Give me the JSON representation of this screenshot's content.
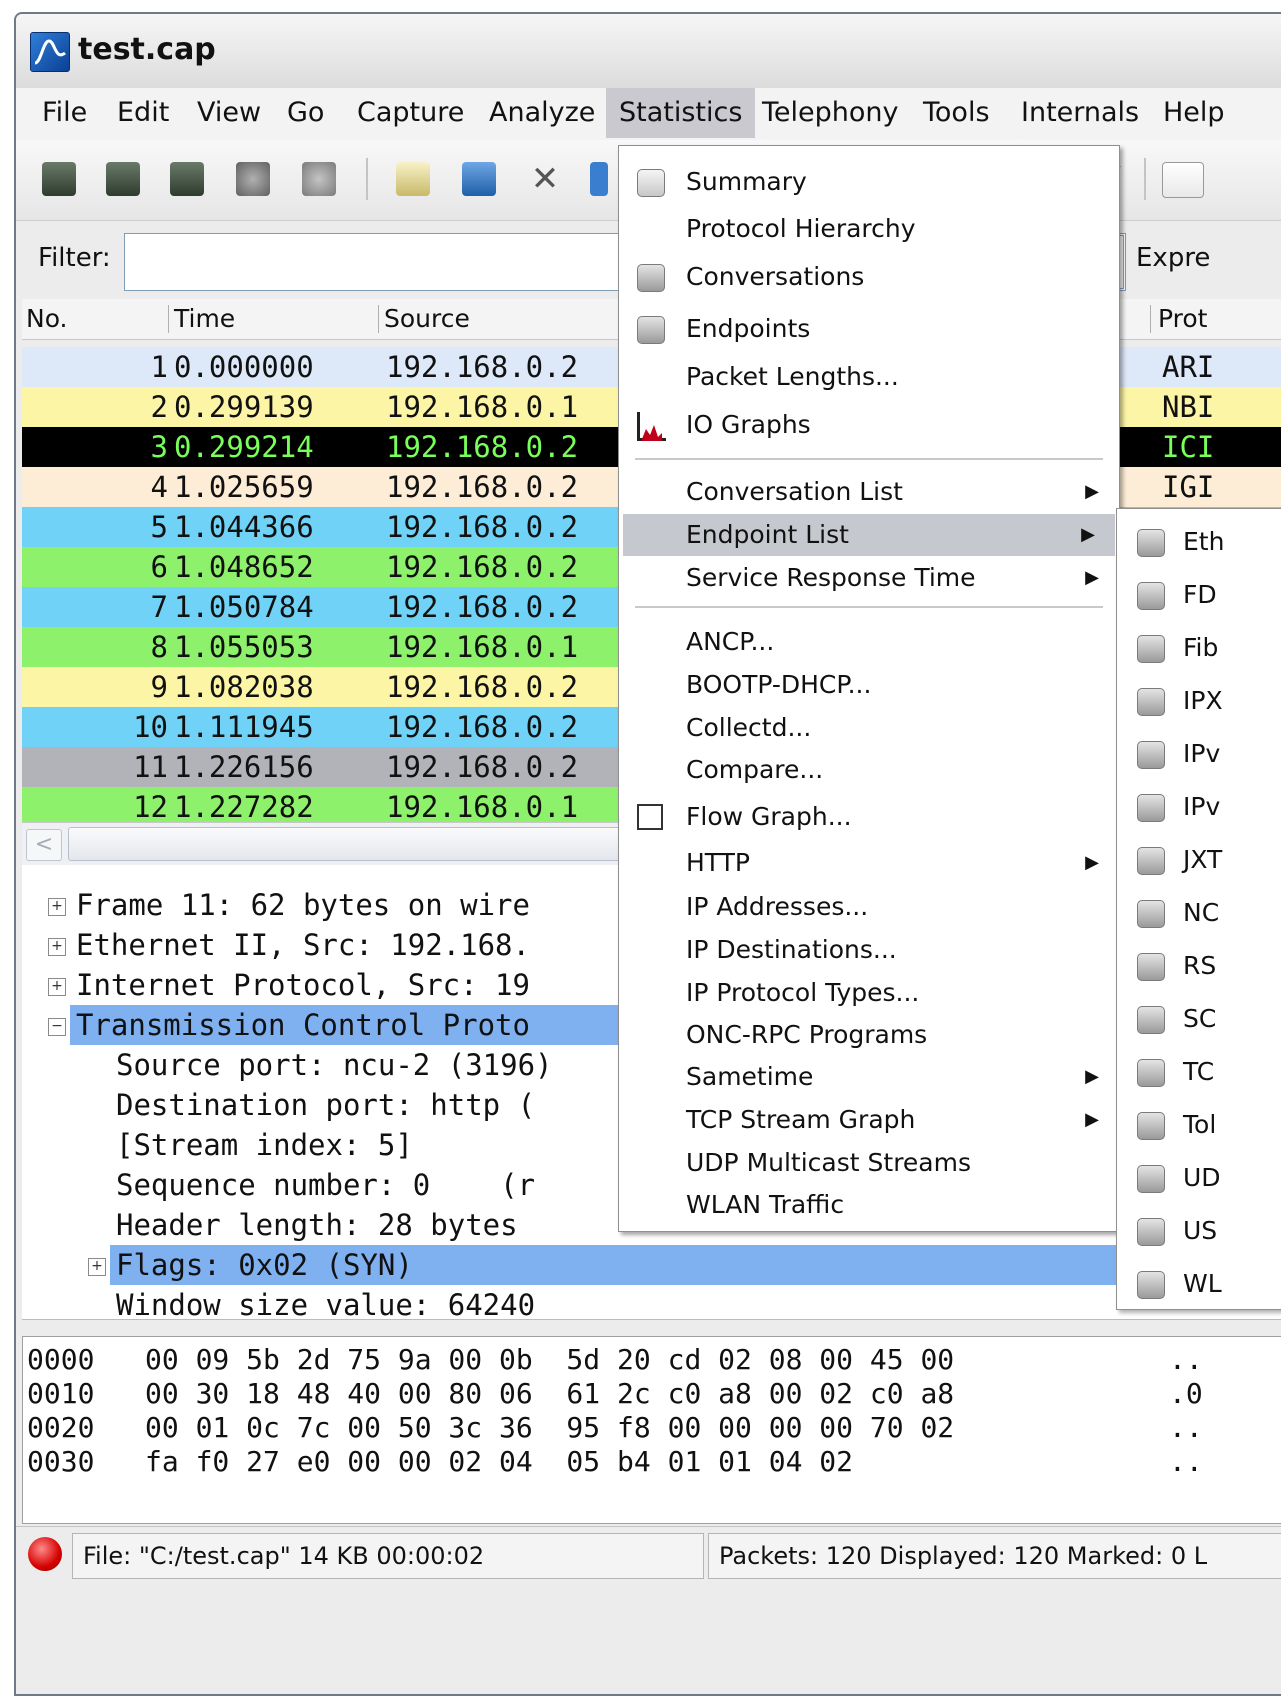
{
  "window": {
    "title": "test.cap"
  },
  "menubar": [
    "File",
    "Edit",
    "View",
    "Go",
    "Capture",
    "Analyze",
    "Statistics",
    "Telephony",
    "Tools",
    "Internals",
    "Help"
  ],
  "filter": {
    "label": "Filter:",
    "value": "",
    "expression": "Expre"
  },
  "packet_list": {
    "columns": [
      "No.",
      "Time",
      "Source",
      "Prot"
    ],
    "rows": [
      {
        "no": "1",
        "time": "0.000000",
        "src": "192.168.0.2",
        "proto": "ARI",
        "bg": "#dde8f8",
        "fg": "#111111"
      },
      {
        "no": "2",
        "time": "0.299139",
        "src": "192.168.0.1",
        "proto": "NBI",
        "bg": "#fdf5a6",
        "fg": "#111111"
      },
      {
        "no": "3",
        "time": "0.299214",
        "src": "192.168.0.2",
        "proto": "ICI",
        "bg": "#000000",
        "fg": "#78ff5a"
      },
      {
        "no": "4",
        "time": "1.025659",
        "src": "192.168.0.2",
        "proto": "IGI",
        "bg": "#fdedd6",
        "fg": "#111111"
      },
      {
        "no": "5",
        "time": "1.044366",
        "src": "192.168.0.2",
        "proto": "",
        "bg": "#6fd2f6",
        "fg": "#111111"
      },
      {
        "no": "6",
        "time": "1.048652",
        "src": "192.168.0.2",
        "proto": "",
        "bg": "#8ef16b",
        "fg": "#111111"
      },
      {
        "no": "7",
        "time": "1.050784",
        "src": "192.168.0.2",
        "proto": "",
        "bg": "#6fd2f6",
        "fg": "#111111"
      },
      {
        "no": "8",
        "time": "1.055053",
        "src": "192.168.0.1",
        "proto": "",
        "bg": "#8ef16b",
        "fg": "#111111"
      },
      {
        "no": "9",
        "time": "1.082038",
        "src": "192.168.0.2",
        "proto": "",
        "bg": "#fdf5a6",
        "fg": "#111111"
      },
      {
        "no": "10",
        "time": "1.111945",
        "src": "192.168.0.2",
        "proto": "",
        "bg": "#6fd2f6",
        "fg": "#111111"
      },
      {
        "no": "11",
        "time": "1.226156",
        "src": "192.168.0.2",
        "proto": "",
        "bg": "#b2b3b9",
        "fg": "#111111"
      },
      {
        "no": "12",
        "time": "1.227282",
        "src": "192.168.0.1",
        "proto": "",
        "bg": "#8ef16b",
        "fg": "#111111"
      }
    ]
  },
  "details": {
    "frame": "Frame 11: 62 bytes on wire",
    "ethernet": "Ethernet II, Src: 192.168.",
    "ip": "Internet Protocol, Src: 19",
    "tcp": "Transmission Control Proto",
    "src_port": "Source port: ncu-2 (3196)",
    "dst_port": "Destination port: http (",
    "stream": "[Stream index: 5]",
    "seq": "Sequence number: 0    (r",
    "hdr_len": "Header length: 28 bytes",
    "flags": "Flags: 0x02 (SYN)",
    "window": "Window size value: 64240"
  },
  "hex": [
    {
      "off": "0000",
      "bytes": "00 09 5b 2d 75 9a 00 0b  5d 20 cd 02 08 00 45 00",
      "ascii": ".."
    },
    {
      "off": "0010",
      "bytes": "00 30 18 48 40 00 80 06  61 2c c0 a8 00 02 c0 a8",
      "ascii": ".0"
    },
    {
      "off": "0020",
      "bytes": "00 01 0c 7c 00 50 3c 36  95 f8 00 00 00 00 70 02",
      "ascii": ".."
    },
    {
      "off": "0030",
      "bytes": "fa f0 27 e0 00 00 02 04  05 b4 01 01 04 02",
      "ascii": ".."
    }
  ],
  "status": {
    "file": "File: \"C:/test.cap\" 14 KB 00:00:02",
    "packets": "Packets: 120 Displayed: 120 Marked: 0 L"
  },
  "statistics_menu": {
    "summary": "Summary",
    "protocol_hierarchy": "Protocol Hierarchy",
    "conversations": "Conversations",
    "endpoints": "Endpoints",
    "packet_lengths": "Packet Lengths...",
    "io_graphs": "IO Graphs",
    "conversation_list": "Conversation List",
    "endpoint_list": "Endpoint List",
    "service_response_time": "Service Response Time",
    "ancp": "ANCP...",
    "bootp": "BOOTP-DHCP...",
    "collectd": "Collectd...",
    "compare": "Compare...",
    "flow_graph": "Flow Graph...",
    "http": "HTTP",
    "ip_addresses": "IP Addresses...",
    "ip_destinations": "IP Destinations...",
    "ip_protocol_types": "IP Protocol Types...",
    "onc_rpc": "ONC-RPC Programs",
    "sametime": "Sametime",
    "tcp_stream_graph": "TCP Stream Graph",
    "udp_multicast": "UDP Multicast Streams",
    "wlan": "WLAN Traffic"
  },
  "endpoint_submenu": [
    "Eth",
    "FD",
    "Fib",
    "IPX",
    "IPv",
    "IPv",
    "JXT",
    "NC",
    "RS",
    "SC",
    "TC",
    "Tol",
    "UD",
    "US",
    "WL"
  ]
}
